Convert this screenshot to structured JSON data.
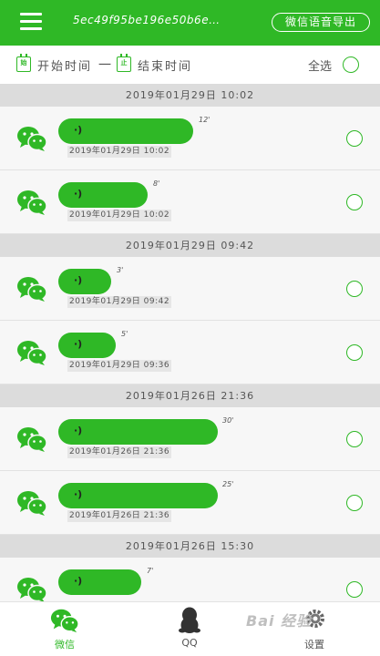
{
  "header": {
    "menu_icon": "hamburger-icon",
    "title": "5ec49f95be196e50b6e…",
    "export_label": "微信语音导出"
  },
  "filter": {
    "start_icon_text": "始",
    "start_label": "开始时间",
    "separator": "一",
    "end_icon_text": "止",
    "end_label": "结束时间",
    "select_all_label": "全选"
  },
  "groups": [
    {
      "date": "2019年01月29日  10:02"
    },
    {
      "date": "2019年01月29日  09:42"
    },
    {
      "date": "2019年01月26日  21:36"
    },
    {
      "date": "2019年01月26日  15:30"
    }
  ],
  "messages": [
    {
      "duration": "12'",
      "timestamp": "2019年01月29日  10:02"
    },
    {
      "duration": "8'",
      "timestamp": "2019年01月29日  10:02"
    },
    {
      "duration": "3'",
      "timestamp": "2019年01月29日  09:42"
    },
    {
      "duration": "5'",
      "timestamp": "2019年01月29日  09:36"
    },
    {
      "duration": "30'",
      "timestamp": "2019年01月26日  21:36"
    },
    {
      "duration": "25'",
      "timestamp": "2019年01月26日  21:36"
    },
    {
      "duration": "7'",
      "timestamp": ""
    }
  ],
  "bottom_nav": {
    "wechat_label": "微信",
    "qq_label": "QQ",
    "settings_label": "设置"
  },
  "watermark": "Bai 经验",
  "colors": {
    "accent": "#2fb826",
    "header_bg": "#dcdcdc"
  }
}
